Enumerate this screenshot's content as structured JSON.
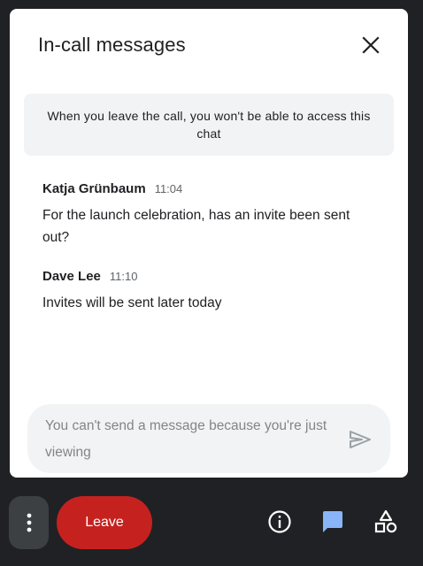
{
  "panel": {
    "title": "In-call messages",
    "close_icon": "close-icon",
    "notice": "When you leave the call, you won't be able to access this chat"
  },
  "messages": [
    {
      "sender": "Katja Grünbaum",
      "time": "11:04",
      "text": "For the launch celebration, has an invite been sent out?"
    },
    {
      "sender": "Dave Lee",
      "time": "11:10",
      "text": "Invites will be sent later today"
    }
  ],
  "composer": {
    "placeholder": "You can't send a message because you're just viewing",
    "send_icon": "send-icon"
  },
  "toolbar": {
    "more_icon": "more-vert-icon",
    "leave_label": "Leave",
    "info_icon": "info-icon",
    "chat_icon": "chat-icon",
    "activities_icon": "shapes-icon"
  },
  "colors": {
    "leave": "#c5221f",
    "chat_active": "#8ab4f8",
    "background": "#202124",
    "panel": "#ffffff"
  }
}
